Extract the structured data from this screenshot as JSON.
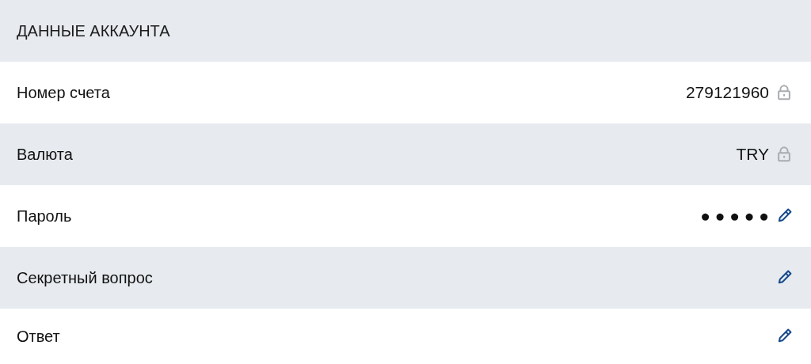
{
  "section_title": "ДАННЫЕ АККАУНТА",
  "rows": [
    {
      "label": "Номер счета",
      "value": "279121960",
      "kind": "locked"
    },
    {
      "label": "Валюта",
      "value": "TRY",
      "kind": "locked"
    },
    {
      "label": "Пароль",
      "value": "● ● ● ● ●",
      "kind": "editable"
    },
    {
      "label": "Секретный вопрос",
      "kind": "editable"
    },
    {
      "label": "Ответ",
      "kind": "editable"
    }
  ]
}
